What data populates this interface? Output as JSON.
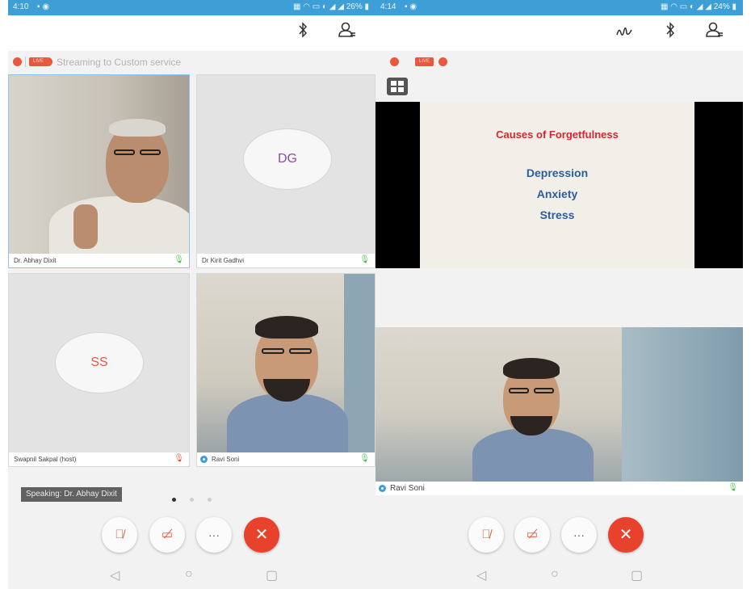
{
  "left": {
    "status": {
      "time": "4:10",
      "right": "26%"
    },
    "stream_label": "Streaming to Custom service",
    "live_label": "LIVE",
    "participants": [
      {
        "name": "Dr. Abhay Dixit",
        "initials": ""
      },
      {
        "name": "Dr Kirit Gadhvi",
        "initials": "DG"
      },
      {
        "name": "Swapnil Sakpal (host)",
        "initials": "SS"
      },
      {
        "name": "Ravi Soni",
        "initials": ""
      }
    ],
    "speaking": "Speaking: Dr. Abhay Dixit"
  },
  "right": {
    "status": {
      "time": "4:14",
      "right": "24%"
    },
    "live_label": "LIVE",
    "slide": {
      "title": "Causes of Forgetfulness",
      "lines": [
        "Depression",
        "Anxiety",
        "Stress"
      ]
    },
    "participant": {
      "name": "Ravi Soni"
    }
  },
  "icons": {
    "bluetooth": "bluetooth-icon",
    "participants": "participants-icon",
    "annotate": "annotate-icon",
    "grid": "grid-view-icon",
    "mic_off": "mic-off-icon",
    "video_off": "video-off-icon",
    "more": "more-icon",
    "end_call": "end-call-icon",
    "nav_back": "nav-back-icon",
    "nav_home": "nav-home-icon",
    "nav_recents": "nav-recents-icon"
  },
  "colors": {
    "accent": "#e8583f",
    "status_bar": "#3d9fd6",
    "end_call": "#e8412c",
    "slide_title": "#d8262e",
    "slide_text": "#2e5d9c"
  }
}
